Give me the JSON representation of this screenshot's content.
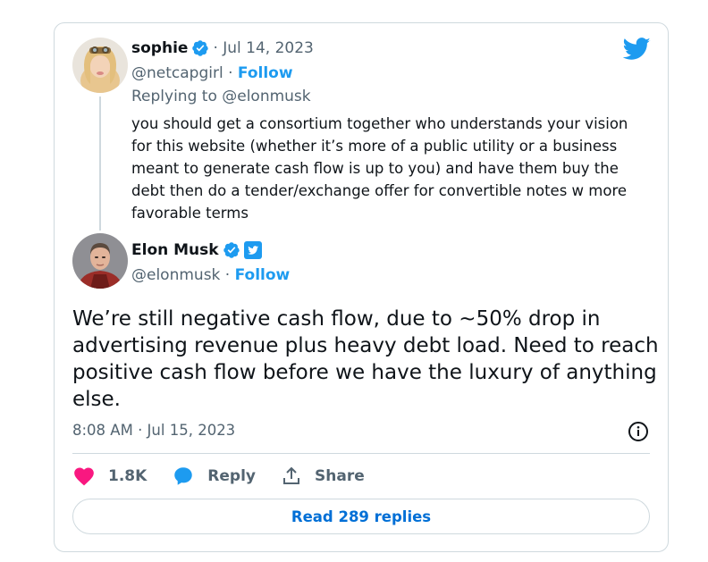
{
  "parent_tweet": {
    "author_name": "sophie",
    "separator_date": "· Jul 14, 2023",
    "handle": "@netcapgirl",
    "dot": " · ",
    "follow_label": "Follow",
    "replying_to": "Replying to @elonmusk",
    "text_lines": [
      "you should get a consortium together who understands your vision",
      "for this website (whether it’s more of a public utility or a business",
      "meant to generate cash flow is up to you) and have them buy the",
      "debt then do a tender/exchange offer for convertible notes w more",
      "favorable terms"
    ]
  },
  "main_tweet": {
    "author_name": "Elon Musk",
    "handle": "@elonmusk",
    "dot": " · ",
    "follow_label": "Follow",
    "text_lines": [
      "We’re still negative cash flow, due to ~50% drop in",
      "advertising revenue plus heavy debt load. Need to reach",
      "positive cash flow before we have the luxury of anything",
      "else."
    ],
    "timestamp": "8:08 AM · Jul 15, 2023"
  },
  "actions": {
    "like_count": "1.8K",
    "reply_label": "Reply",
    "share_label": "Share"
  },
  "read_replies_label": "Read 289 replies",
  "colors": {
    "accent": "#1d9bf0",
    "like": "#f91880",
    "text": "#0f1419",
    "secondary": "#536471",
    "border": "#cfd9de",
    "link": "#006fd6"
  }
}
